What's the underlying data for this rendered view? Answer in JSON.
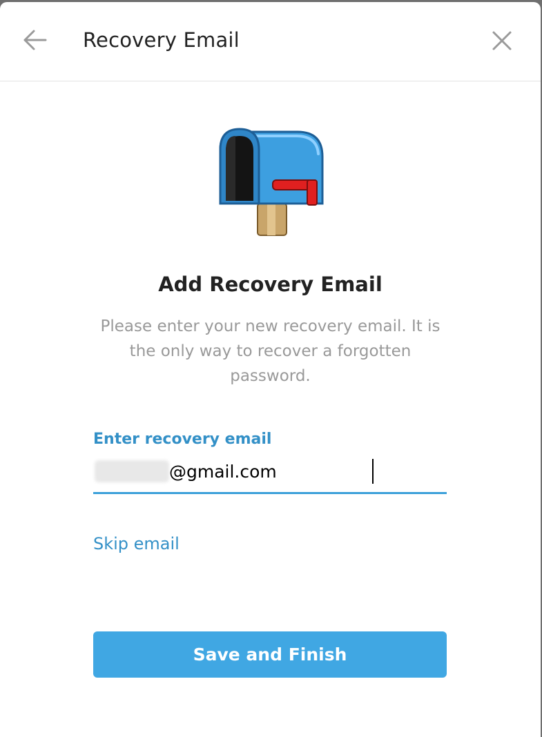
{
  "header": {
    "title": "Recovery Email",
    "back_icon": "arrow-left-icon",
    "close_icon": "close-icon"
  },
  "hero": {
    "icon": "mailbox-icon"
  },
  "main": {
    "title": "Add Recovery Email",
    "description": "Please enter your new recovery email. It is the only way to recover a forgotten password."
  },
  "form": {
    "email_label": "Enter recovery email",
    "email_value": "@gmail.com",
    "skip_label": "Skip email"
  },
  "actions": {
    "save_label": "Save and Finish"
  },
  "colors": {
    "accent": "#40a7e3",
    "link": "#3390c7",
    "text_primary": "#222222",
    "text_secondary": "#999999"
  }
}
